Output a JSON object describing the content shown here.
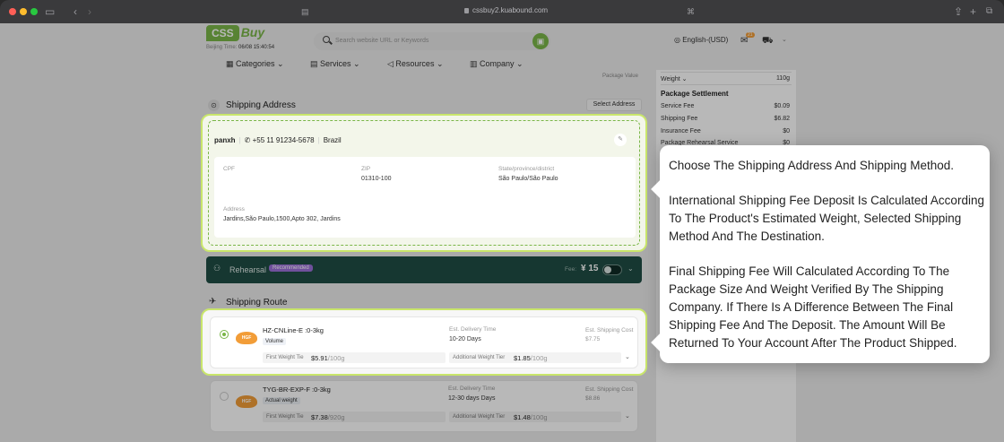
{
  "browser": {
    "url": "cssbuy2.kuabound.com"
  },
  "header": {
    "logo_box": "CSS",
    "logo_buy": "Buy",
    "beijing_label": "Beijing Time:",
    "beijing_time": "06/08 15:40:54",
    "search_placeholder": "Search website URL or Keywords",
    "language": "English-(USD)",
    "cart_badge": "21"
  },
  "nav": [
    "Categories",
    "Services",
    "Resources",
    "Company"
  ],
  "package_value_label": "Package Value",
  "shipping_address": {
    "title": "Shipping Address",
    "select_button": "Select Address",
    "name": "panxh",
    "phone": "+55 11 91234-5678",
    "country": "Brazil",
    "cpf_label": "CPF",
    "zip_label": "ZIP",
    "zip": "01310-100",
    "state_label": "State/province/district",
    "state": "São Paulo/São Paulo",
    "address_label": "Address",
    "address": "Jardins,São Paulo,1500,Apto 302, Jardins"
  },
  "rehearsal": {
    "title": "Rehearsal",
    "recommended": "Recommended",
    "fee_label": "Fee:",
    "amount": "¥ 15"
  },
  "shipping_route": {
    "title": "Shipping Route",
    "routes": [
      {
        "name": "HZ-CNLine-E :0-3kg",
        "tag": "Volume",
        "delivery_label": "Est. Delivery Time",
        "delivery": "10-20 Days",
        "cost_label": "Est. Shipping Cost",
        "cost": "$7.75",
        "first_tier_label": "First Weight Tie",
        "first_tier_value": "$5.91",
        "first_tier_unit": "/100g",
        "add_tier_label": "Additional Weight Tier",
        "add_tier_value": "$1.85",
        "add_tier_unit": "/100g"
      },
      {
        "name": "TYG-BR-EXP-F :0-3kg",
        "tag": "Actual weight",
        "delivery_label": "Est. Delivery Time",
        "delivery": "12-30 days Days",
        "cost_label": "Est. Shipping Cost",
        "cost": "$8.86",
        "first_tier_label": "First Weight Tie",
        "first_tier_value": "$7.38",
        "first_tier_unit": "/920g",
        "add_tier_label": "Additional Weight Tier",
        "add_tier_value": "$1.48",
        "add_tier_unit": "/100g"
      }
    ]
  },
  "settlement": {
    "weight_label": "Weight",
    "weight": "110g",
    "title": "Package Settlement",
    "rows": [
      {
        "label": "Service Fee",
        "value": "$0.09"
      },
      {
        "label": "Shipping Fee",
        "value": "$6.82"
      },
      {
        "label": "Insurance Fee",
        "value": "$0"
      },
      {
        "label": "Package Rehearsal Service",
        "value": "$0"
      }
    ]
  },
  "tooltip": {
    "p1": "Choose The Shipping Address And Shipping Method.",
    "p2": "International Shipping Fee Deposit Is Calculated According To The Product's Estimated Weight, Selected Shipping Method And The Destination.",
    "p3": "Final Shipping Fee Will Calculated According To The Package Size And Weight Verified By The Shipping Company. If There Is A Difference Between The Final Shipping Fee And The Deposit. The Amount Will Be Returned To Your Account After The Product Shipped."
  }
}
